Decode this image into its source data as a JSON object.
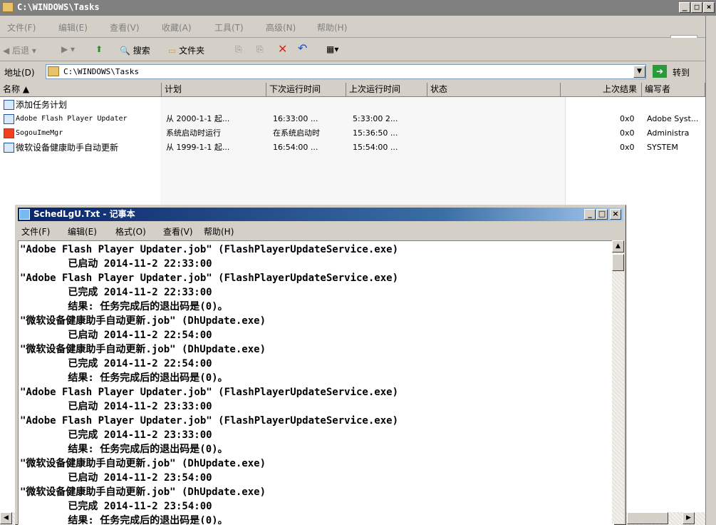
{
  "explorer": {
    "title": "C:\\WINDOWS\\Tasks",
    "menu": [
      "文件(F)",
      "编辑(E)",
      "查看(V)",
      "收藏(A)",
      "工具(T)",
      "高级(N)",
      "帮助(H)"
    ],
    "toolbar": {
      "back": "后退",
      "search": "搜索",
      "folders": "文件夹"
    },
    "address_label": "地址(D)",
    "address_value": "C:\\WINDOWS\\Tasks",
    "go_label": "转到",
    "columns": [
      "名称",
      "计划",
      "下次运行时间",
      "上次运行时间",
      "状态",
      "上次结果",
      "编写者"
    ],
    "rows": [
      {
        "name": "添加任务计划",
        "schedule": "",
        "next": "",
        "last": "",
        "result": "",
        "author": ""
      },
      {
        "name": "Adobe Flash Player Updater",
        "schedule": "从 2000-1-1 起...",
        "next": "16:33:00 ...",
        "last": "5:33:00 2...",
        "result": "0x0",
        "author": "Adobe Syst..."
      },
      {
        "name": "SogouImeMgr",
        "schedule": "系统启动时运行",
        "next": "在系统启动时",
        "last": "15:36:50 ...",
        "result": "0x0",
        "author": "Administra"
      },
      {
        "name": "微软设备健康助手自动更新",
        "schedule": "从 1999-1-1 起...",
        "next": "16:54:00 ...",
        "last": "15:54:00 ...",
        "result": "0x0",
        "author": "SYSTEM"
      }
    ]
  },
  "notepad": {
    "title": "SchedLgU.Txt - 记事本",
    "menu": [
      "文件(F)",
      "编辑(E)",
      "格式(O)",
      "查看(V)",
      "帮助(H)"
    ],
    "lines": [
      "\"Adobe Flash Player Updater.job\" (FlashPlayerUpdateService.exe)",
      "        已启动 2014-11-2 22:33:00",
      "\"Adobe Flash Player Updater.job\" (FlashPlayerUpdateService.exe)",
      "        已完成 2014-11-2 22:33:00",
      "        结果: 任务完成后的退出码是(0)。",
      "\"微软设备健康助手自动更新.job\" (DhUpdate.exe)",
      "        已启动 2014-11-2 22:54:00",
      "\"微软设备健康助手自动更新.job\" (DhUpdate.exe)",
      "        已完成 2014-11-2 22:54:00",
      "        结果: 任务完成后的退出码是(0)。",
      "\"Adobe Flash Player Updater.job\" (FlashPlayerUpdateService.exe)",
      "        已启动 2014-11-2 23:33:00",
      "\"Adobe Flash Player Updater.job\" (FlashPlayerUpdateService.exe)",
      "        已完成 2014-11-2 23:33:00",
      "        结果: 任务完成后的退出码是(0)。",
      "\"微软设备健康助手自动更新.job\" (DhUpdate.exe)",
      "        已启动 2014-11-2 23:54:00",
      "\"微软设备健康助手自动更新.job\" (DhUpdate.exe)",
      "        已完成 2014-11-2 23:54:00",
      "        结果: 任务完成后的退出码是(0)。"
    ]
  }
}
